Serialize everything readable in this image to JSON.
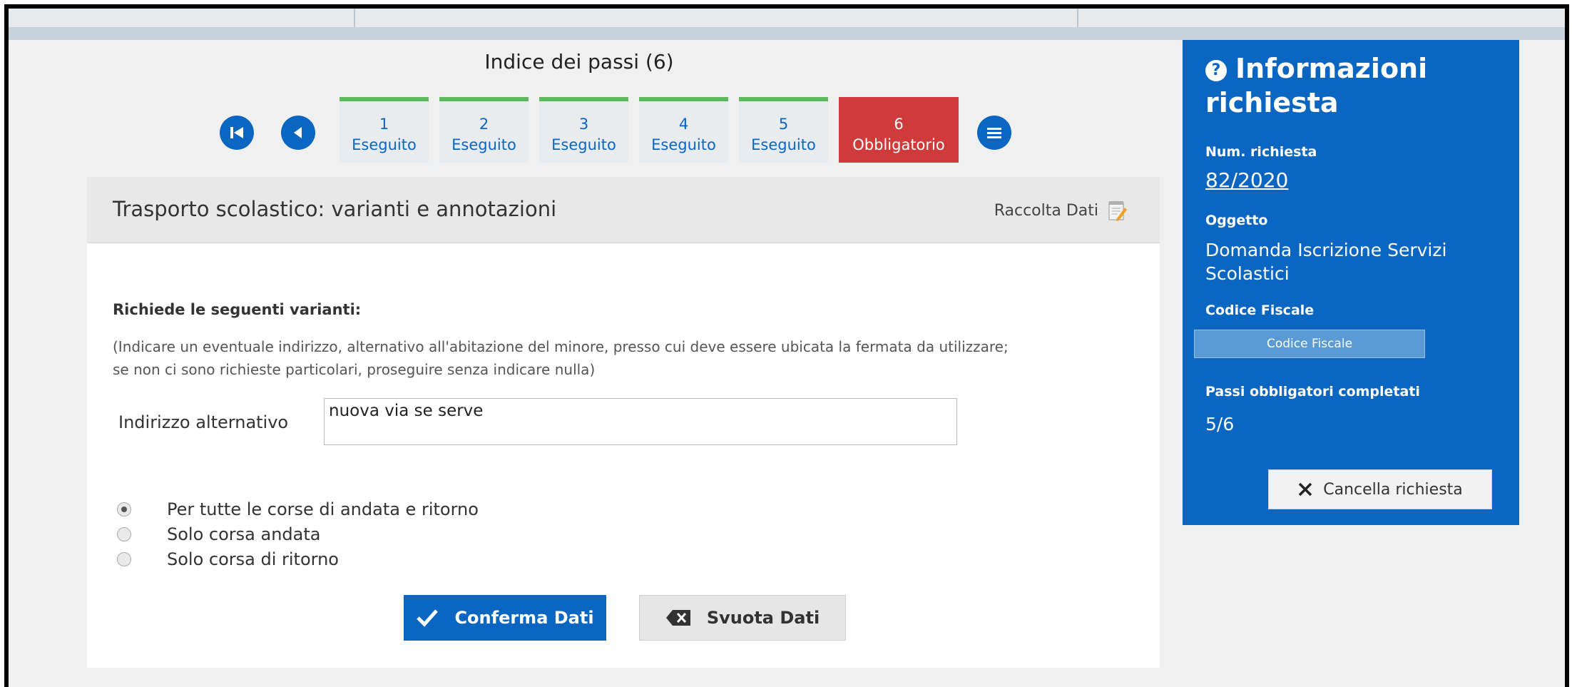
{
  "steps_index": {
    "title": "Indice dei passi (6)",
    "steps": [
      {
        "number": "1",
        "status": "Eseguito"
      },
      {
        "number": "2",
        "status": "Eseguito"
      },
      {
        "number": "3",
        "status": "Eseguito"
      },
      {
        "number": "4",
        "status": "Eseguito"
      },
      {
        "number": "5",
        "status": "Eseguito"
      },
      {
        "number": "6",
        "status": "Obbligatorio"
      }
    ]
  },
  "panel": {
    "title": "Trasporto scolastico: varianti e annotazioni",
    "raccolta": "Raccolta Dati",
    "request_label": "Richiede le seguenti varianti:",
    "hint_line1": "(Indicare un eventuale indirizzo, alternativo all'abitazione del minore, presso cui deve essere ubicata la fermata da utilizzare;",
    "hint_line2": "se non ci sono richieste particolari, proseguire senza indicare nulla)",
    "indirizzo_label": "Indirizzo alternativo",
    "indirizzo_value": "nuova via se serve",
    "radio_options": [
      {
        "label": "Per tutte le corse di andata e ritorno",
        "selected": true
      },
      {
        "label": "Solo corsa andata",
        "selected": false
      },
      {
        "label": "Solo corsa di ritorno",
        "selected": false
      }
    ],
    "confirm_label": "Conferma Dati",
    "clear_label": "Svuota Dati"
  },
  "sidebar": {
    "title": "Informazioni richiesta",
    "num_label": "Num. richiesta",
    "num_value": "82/2020",
    "oggetto_label": "Oggetto",
    "oggetto_value": "Domanda Iscrizione Servizi Scolastici",
    "cf_label": "Codice Fiscale",
    "cf_value": "Codice Fiscale",
    "passi_label": "Passi obbligatori completati",
    "passi_value": "5/6",
    "cancel_label": "Cancella richiesta"
  },
  "colors": {
    "primary": "#0b66c2",
    "done": "#5cb85c",
    "mandatory": "#cf3a3a"
  }
}
